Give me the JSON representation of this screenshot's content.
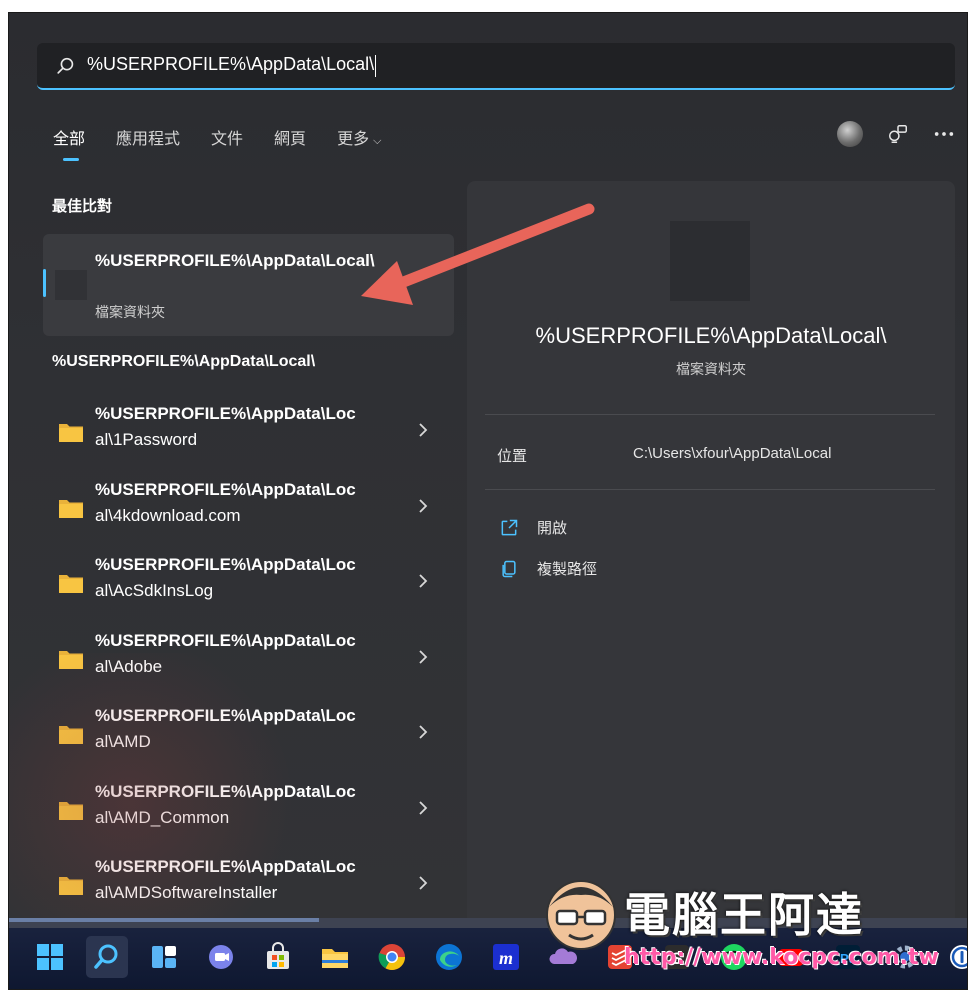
{
  "search": {
    "query": "%USERPROFILE%\\AppData\\Local\\"
  },
  "tabs": [
    {
      "label": "全部",
      "active": true
    },
    {
      "label": "應用程式"
    },
    {
      "label": "文件"
    },
    {
      "label": "網頁"
    },
    {
      "label": "更多"
    }
  ],
  "header_icons": [
    "avatar",
    "rewards-icon",
    "more-options-icon"
  ],
  "best_match": {
    "heading": "最佳比對",
    "title": "%USERPROFILE%\\AppData\\Local\\",
    "subtitle": "檔案資料夾"
  },
  "folder_group": {
    "heading": "%USERPROFILE%\\AppData\\Local\\",
    "items": [
      {
        "line1": "%USERPROFILE%\\AppData\\Loc",
        "line2": "al\\1Password"
      },
      {
        "line1": "%USERPROFILE%\\AppData\\Loc",
        "line2": "al\\4kdownload.com"
      },
      {
        "line1": "%USERPROFILE%\\AppData\\Loc",
        "line2": "al\\AcSdkInsLog"
      },
      {
        "line1": "%USERPROFILE%\\AppData\\Loc",
        "line2": "al\\Adobe"
      },
      {
        "line1": "%USERPROFILE%\\AppData\\Loc",
        "line2": "al\\AMD"
      },
      {
        "line1": "%USERPROFILE%\\AppData\\Loc",
        "line2": "al\\AMD_Common"
      },
      {
        "line1": "%USERPROFILE%\\AppData\\Loc",
        "line2": "al\\AMDSoftwareInstaller"
      }
    ]
  },
  "preview": {
    "title": "%USERPROFILE%\\AppData\\Local\\",
    "subtitle": "檔案資料夾",
    "location_label": "位置",
    "location_value": "C:\\Users\\xfour\\AppData\\Local",
    "actions": [
      {
        "label": "開啟",
        "icon": "open-external-icon"
      },
      {
        "label": "複製路徑",
        "icon": "copy-path-icon"
      }
    ]
  },
  "watermark": {
    "text": "電腦王阿達",
    "url": "http://www.kocpc.com.tw"
  },
  "taskbar": [
    "start-icon",
    "search-icon",
    "widgets-icon",
    "teams-chat-icon",
    "store-icon",
    "file-explorer-icon",
    "chrome-icon",
    "edge-icon",
    "app-m-icon",
    "onedrive-icon",
    "todoist-icon",
    "app-s-icon",
    "spotify-icon",
    "youtube-icon",
    "photoshop-icon",
    "settings-icon",
    "1password-icon"
  ],
  "colors": {
    "accent": "#4cc2ff",
    "panel": "#2e2f33",
    "card": "#3a3b3f",
    "arrow": "#e8655a",
    "folder": "#f8c542"
  }
}
